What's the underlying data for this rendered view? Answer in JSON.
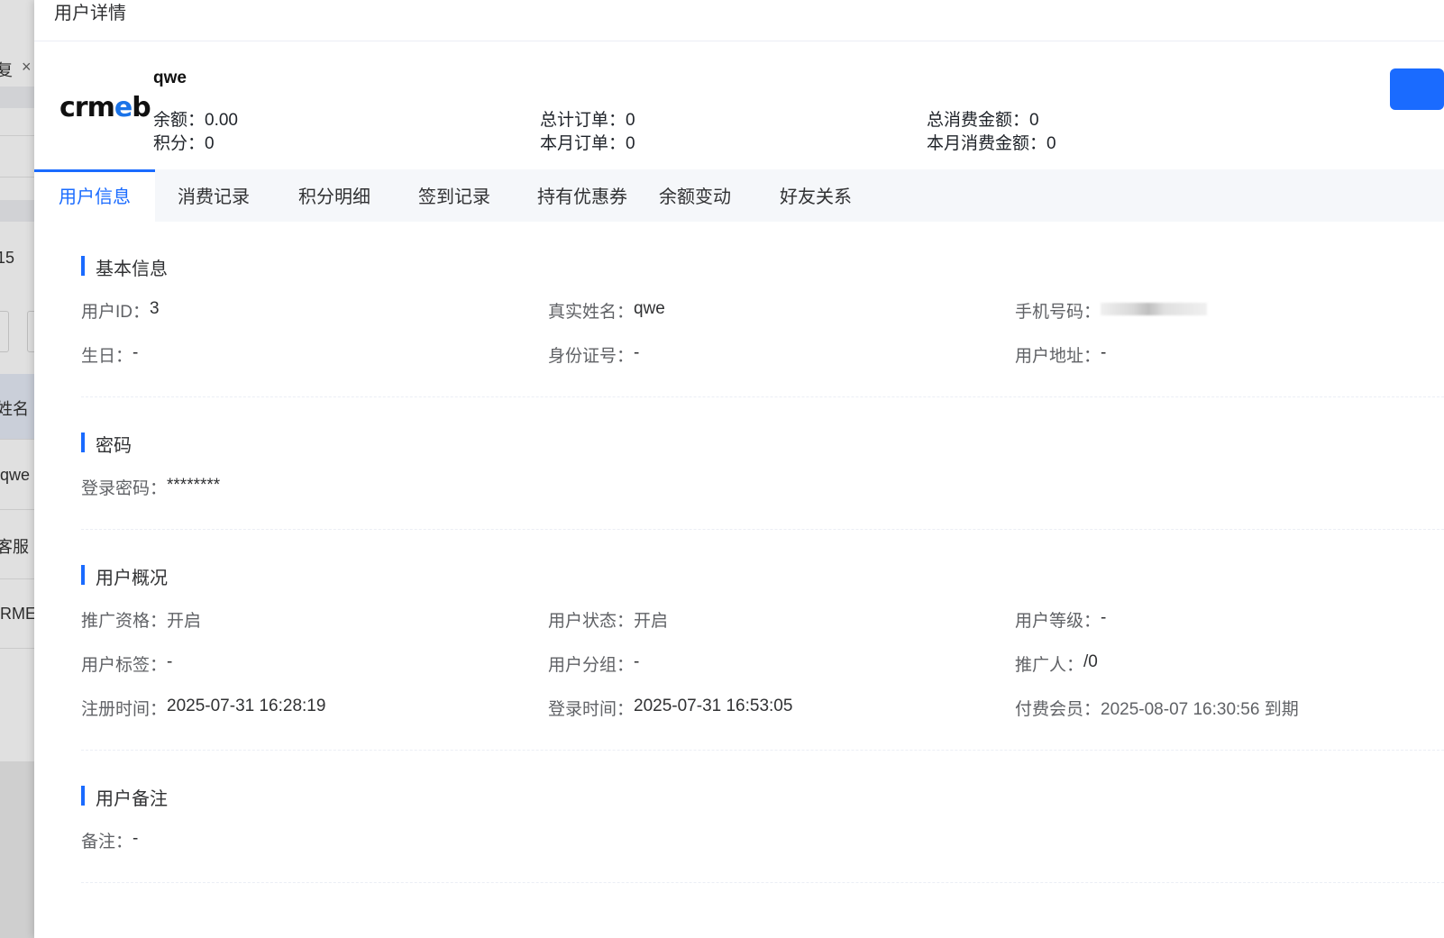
{
  "background": {
    "tab_close_text": "复",
    "row_texts": [
      "15",
      "姓名",
      "qwe",
      "客服",
      "RME"
    ]
  },
  "drawer": {
    "title": "用户详情"
  },
  "profile": {
    "logo_text": "crmeb",
    "username": "qwe",
    "stats": [
      {
        "label": "余额：",
        "value": "0.00"
      },
      {
        "label": "积分：",
        "value": "0"
      },
      {
        "label": "总计订单：",
        "value": "0"
      },
      {
        "label": "本月订单：",
        "value": "0"
      },
      {
        "label": "总消费金额：",
        "value": "0"
      },
      {
        "label": "本月消费金额：",
        "value": "0"
      }
    ]
  },
  "tabs": [
    {
      "label": "用户信息",
      "active": true
    },
    {
      "label": "消费记录",
      "active": false
    },
    {
      "label": "积分明细",
      "active": false
    },
    {
      "label": "签到记录",
      "active": false
    },
    {
      "label": "持有优惠券",
      "active": false
    },
    {
      "label": "余额变动",
      "active": false
    },
    {
      "label": "好友关系",
      "active": false
    }
  ],
  "sections": {
    "basic": {
      "title": "基本信息",
      "fields": [
        {
          "label": "用户ID：",
          "value": "3"
        },
        {
          "label": "真实姓名：",
          "value": "qwe"
        },
        {
          "label": "手机号码：",
          "value": ""
        },
        {
          "label": "生日：",
          "value": "-"
        },
        {
          "label": "身份证号：",
          "value": "-"
        },
        {
          "label": "用户地址：",
          "value": "-"
        }
      ]
    },
    "password": {
      "title": "密码",
      "fields": [
        {
          "label": "登录密码：",
          "value": "********"
        }
      ]
    },
    "overview": {
      "title": "用户概况",
      "fields": [
        {
          "label": "推广资格：",
          "value": "开启"
        },
        {
          "label": "用户状态：",
          "value": "开启"
        },
        {
          "label": "用户等级：",
          "value": "-"
        },
        {
          "label": "用户标签：",
          "value": "-"
        },
        {
          "label": "用户分组：",
          "value": "-"
        },
        {
          "label": "推广人：",
          "value": "/0"
        },
        {
          "label": "注册时间：",
          "value": "2025-07-31 16:28:19"
        },
        {
          "label": "登录时间：",
          "value": "2025-07-31 16:53:05"
        },
        {
          "label": "付费会员：",
          "value": "2025-08-07 16:30:56 到期"
        }
      ]
    },
    "remark": {
      "title": "用户备注",
      "fields": [
        {
          "label": "备注：",
          "value": "-"
        }
      ]
    }
  },
  "colors": {
    "accent": "#1a6bff",
    "label": "#606266",
    "text": "#303133"
  }
}
